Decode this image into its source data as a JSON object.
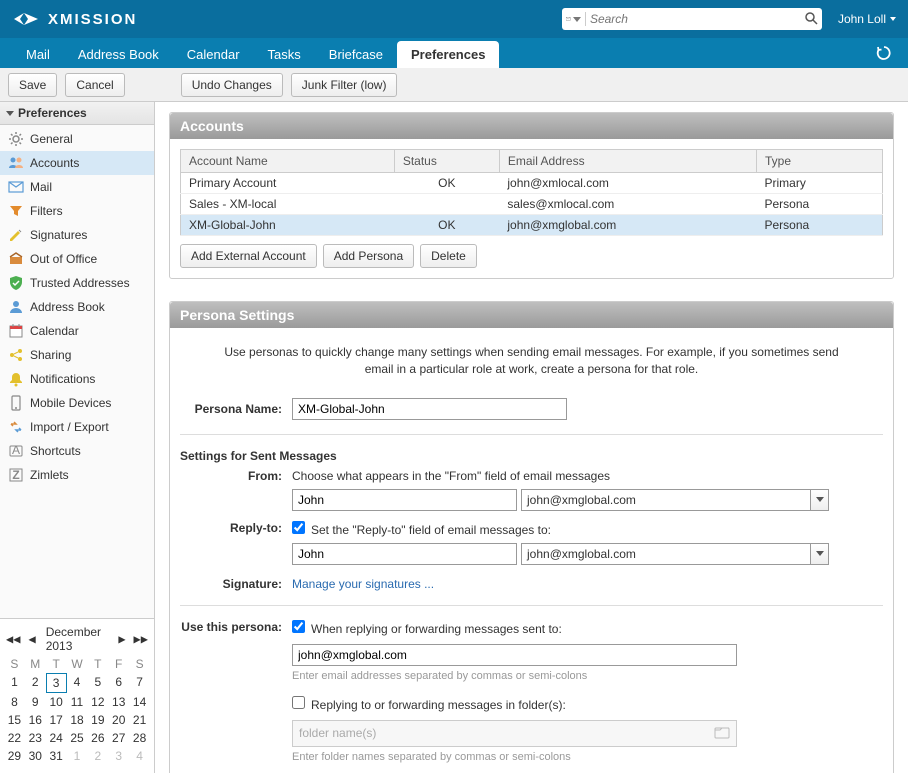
{
  "brand": "XMISSION",
  "search": {
    "placeholder": "Search"
  },
  "user": "John Loll",
  "tabs": [
    "Mail",
    "Address Book",
    "Calendar",
    "Tasks",
    "Briefcase",
    "Preferences"
  ],
  "active_tab": 5,
  "toolbar": {
    "save": "Save",
    "cancel": "Cancel",
    "undo": "Undo Changes",
    "junk": "Junk Filter (low)"
  },
  "side_header": "Preferences",
  "side_items": [
    {
      "icon": "gear",
      "label": "General"
    },
    {
      "icon": "accounts",
      "label": "Accounts",
      "sel": true
    },
    {
      "icon": "mail",
      "label": "Mail"
    },
    {
      "icon": "filter",
      "label": "Filters"
    },
    {
      "icon": "sig",
      "label": "Signatures"
    },
    {
      "icon": "ooo",
      "label": "Out of Office"
    },
    {
      "icon": "shield",
      "label": "Trusted Addresses"
    },
    {
      "icon": "person",
      "label": "Address Book"
    },
    {
      "icon": "cal",
      "label": "Calendar"
    },
    {
      "icon": "share",
      "label": "Sharing"
    },
    {
      "icon": "bell",
      "label": "Notifications"
    },
    {
      "icon": "mobile",
      "label": "Mobile Devices"
    },
    {
      "icon": "impexp",
      "label": "Import / Export"
    },
    {
      "icon": "shortcut",
      "label": "Shortcuts"
    },
    {
      "icon": "zimlet",
      "label": "Zimlets"
    }
  ],
  "calendar": {
    "title": "December 2013",
    "dow": [
      "S",
      "M",
      "T",
      "W",
      "T",
      "F",
      "S"
    ],
    "weeks": [
      [
        {
          "n": 1
        },
        {
          "n": 2
        },
        {
          "n": 3,
          "today": true
        },
        {
          "n": 4
        },
        {
          "n": 5
        },
        {
          "n": 6
        },
        {
          "n": 7
        }
      ],
      [
        {
          "n": 8
        },
        {
          "n": 9
        },
        {
          "n": 10
        },
        {
          "n": 11
        },
        {
          "n": 12
        },
        {
          "n": 13
        },
        {
          "n": 14
        }
      ],
      [
        {
          "n": 15
        },
        {
          "n": 16
        },
        {
          "n": 17
        },
        {
          "n": 18
        },
        {
          "n": 19
        },
        {
          "n": 20
        },
        {
          "n": 21
        }
      ],
      [
        {
          "n": 22
        },
        {
          "n": 23
        },
        {
          "n": 24
        },
        {
          "n": 25
        },
        {
          "n": 26
        },
        {
          "n": 27
        },
        {
          "n": 28
        }
      ],
      [
        {
          "n": 29
        },
        {
          "n": 30
        },
        {
          "n": 31
        },
        {
          "n": 1,
          "dim": true
        },
        {
          "n": 2,
          "dim": true
        },
        {
          "n": 3,
          "dim": true
        },
        {
          "n": 4,
          "dim": true
        }
      ]
    ]
  },
  "accounts_panel": {
    "title": "Accounts",
    "cols": [
      "Account Name",
      "Status",
      "Email Address",
      "Type"
    ],
    "rows": [
      {
        "name": "Primary Account",
        "status": "OK",
        "email": "john@xmlocal.com",
        "type": "Primary"
      },
      {
        "name": "Sales - XM-local",
        "status": "",
        "email": "sales@xmlocal.com",
        "type": "Persona"
      },
      {
        "name": "XM-Global-John",
        "status": "OK",
        "email": "john@xmglobal.com",
        "type": "Persona",
        "sel": true
      }
    ],
    "buttons": {
      "add_ext": "Add External Account",
      "add_persona": "Add Persona",
      "delete": "Delete"
    }
  },
  "persona": {
    "title": "Persona Settings",
    "help": "Use personas to quickly change many settings when sending email messages. For example, if you sometimes send email in a particular role at work, create a persona for that role.",
    "name_label": "Persona Name:",
    "name_value": "XM-Global-John",
    "sent_header": "Settings for Sent Messages",
    "from_label": "From:",
    "from_desc": "Choose what appears in the \"From\" field of email messages",
    "from_name": "John",
    "from_email": "john@xmglobal.com",
    "reply_label": "Reply-to:",
    "reply_check": "Set the \"Reply-to\" field of email messages to:",
    "reply_name": "John",
    "reply_email": "john@xmglobal.com",
    "sig_label": "Signature:",
    "sig_link": "Manage your signatures ...",
    "use_label": "Use this persona:",
    "use_check": "When replying or forwarding messages sent to:",
    "use_email": "john@xmglobal.com",
    "use_hint": "Enter email addresses separated by commas or semi-colons",
    "folder_check": "Replying to or forwarding messages in folder(s):",
    "folder_placeholder": "folder name(s)",
    "folder_hint": "Enter folder names separated by commas or semi-colons"
  }
}
